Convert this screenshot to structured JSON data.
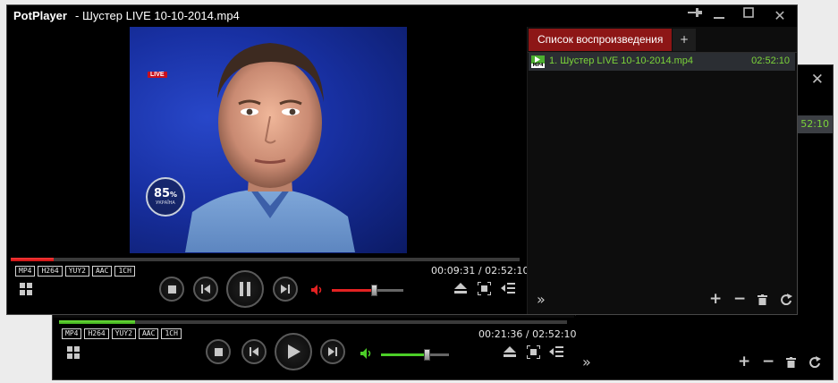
{
  "back_window": {
    "playlist_time": "52:10",
    "badges": [
      "MP4",
      "H264",
      "YUY2",
      "AAC",
      "1CH"
    ],
    "time_current": "00:21:36",
    "time_total": "02:52:10",
    "seek_progress": 0.15,
    "volume_level": 0.67,
    "accent_color": "#4ccf28"
  },
  "front_window": {
    "app_name": "PotPlayer",
    "title": "- Шустер LIVE 10-10-2014.mp4",
    "titlebar_buttons": [
      "pin-icon",
      "minimize-icon",
      "maximize-icon",
      "close-icon"
    ],
    "video": {
      "live_logo": "LIVE",
      "rating_number": "85",
      "rating_sign": "%",
      "rating_caption": "УКРАЇНА"
    },
    "badges": [
      "MP4",
      "H264",
      "YUY2",
      "AAC",
      "1CH"
    ],
    "time_current": "00:09:31",
    "time_total": "02:52:10",
    "seek_progress": 0.085,
    "volume_level": 0.59,
    "accent_color": "#e32222"
  },
  "playlist": {
    "tab_label": "Список воспроизведения",
    "add_tab_label": "+",
    "items": [
      {
        "name": "1. Шустер LIVE 10-10-2014.mp4",
        "duration": "02:52:10",
        "format": "MP4"
      }
    ],
    "footer_icons": [
      "expand-icon",
      "add-icon",
      "remove-icon",
      "trash-icon",
      "repeat-icon"
    ]
  }
}
